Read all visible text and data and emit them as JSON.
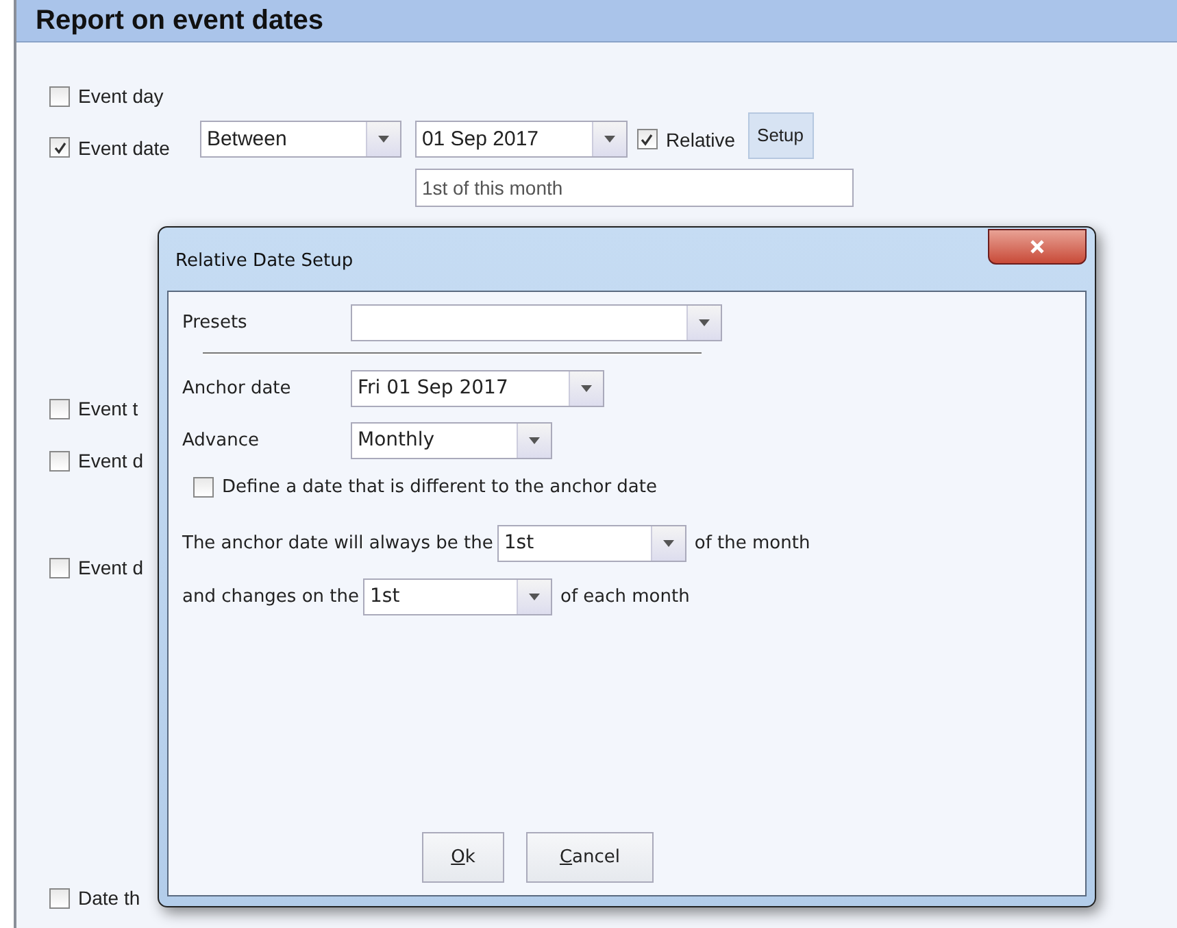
{
  "page": {
    "title": "Report on event dates"
  },
  "rows": [
    {
      "kind": "check",
      "label": "Event day",
      "checked": false
    },
    {
      "kind": "date",
      "label": "Event date",
      "checked": true,
      "mode": "Between",
      "date": "01 Sep 2017",
      "relative": {
        "label": "Relative",
        "checked": true
      },
      "setup": "Setup",
      "description": "1st of this month"
    },
    {
      "kind": "check",
      "label": "Event t",
      "checked": false
    },
    {
      "kind": "check",
      "label": "Event d",
      "checked": false
    },
    {
      "kind": "check",
      "label": "Event d",
      "checked": false
    },
    {
      "kind": "check",
      "label": "Date th",
      "checked": false
    }
  ],
  "dialog": {
    "title": "Relative Date Setup",
    "presets": {
      "label": "Presets"
    },
    "anchor_date": {
      "label": "Anchor date",
      "value": "Fri 01 Sep 2017"
    },
    "advance": {
      "label": "Advance",
      "value": "Monthly"
    },
    "define_different": {
      "label": "Define a date that is different to the anchor date",
      "checked": false
    },
    "anchor_line": {
      "before": "The anchor date will always be the",
      "value": "1st",
      "after": "of the month"
    },
    "change_line": {
      "before": "and changes on the",
      "value": "1st",
      "after": "of each month"
    },
    "buttons": [
      "Ok",
      "Cancel"
    ]
  }
}
